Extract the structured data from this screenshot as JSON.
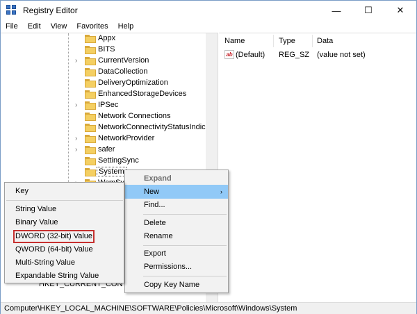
{
  "window": {
    "title": "Registry Editor",
    "minimize": "—",
    "maximize": "☐",
    "close": "✕"
  },
  "menubar": {
    "items": [
      "File",
      "Edit",
      "View",
      "Favorites",
      "Help"
    ]
  },
  "tree": {
    "items": [
      {
        "label": "Appx",
        "expandable": false
      },
      {
        "label": "BITS",
        "expandable": false
      },
      {
        "label": "CurrentVersion",
        "expandable": true
      },
      {
        "label": "DataCollection",
        "expandable": false
      },
      {
        "label": "DeliveryOptimization",
        "expandable": false
      },
      {
        "label": "EnhancedStorageDevices",
        "expandable": false
      },
      {
        "label": "IPSec",
        "expandable": true
      },
      {
        "label": "Network Connections",
        "expandable": false
      },
      {
        "label": "NetworkConnectivityStatusIndicat",
        "expandable": false
      },
      {
        "label": "NetworkProvider",
        "expandable": true
      },
      {
        "label": "safer",
        "expandable": true
      },
      {
        "label": "SettingSync",
        "expandable": false
      },
      {
        "label": "System",
        "expandable": false,
        "selected": true
      },
      {
        "label": "WcmSvc",
        "expandable": true
      }
    ],
    "partial_key": "HKEY_CURRENT_CONFIG"
  },
  "list": {
    "columns": [
      "Name",
      "Type",
      "Data"
    ],
    "rows": [
      {
        "name": "(Default)",
        "type": "REG_SZ",
        "data": "(value not set)"
      }
    ]
  },
  "context_menu": {
    "expand": "Expand",
    "new": "New",
    "find": "Find...",
    "delete": "Delete",
    "rename": "Rename",
    "export": "Export",
    "permissions": "Permissions...",
    "copy_key_name": "Copy Key Name"
  },
  "submenu": {
    "key": "Key",
    "string_value": "String Value",
    "binary_value": "Binary Value",
    "dword_value": "DWORD (32-bit) Value",
    "qword_value": "QWORD (64-bit) Value",
    "multi_string_value": "Multi-String Value",
    "expandable_string_value": "Expandable String Value"
  },
  "statusbar": {
    "path": "Computer\\HKEY_LOCAL_MACHINE\\SOFTWARE\\Policies\\Microsoft\\Windows\\System"
  },
  "colors": {
    "highlight": "#91c9f7",
    "folder": "#f4cf62",
    "annotation_box": "#c6302f"
  }
}
